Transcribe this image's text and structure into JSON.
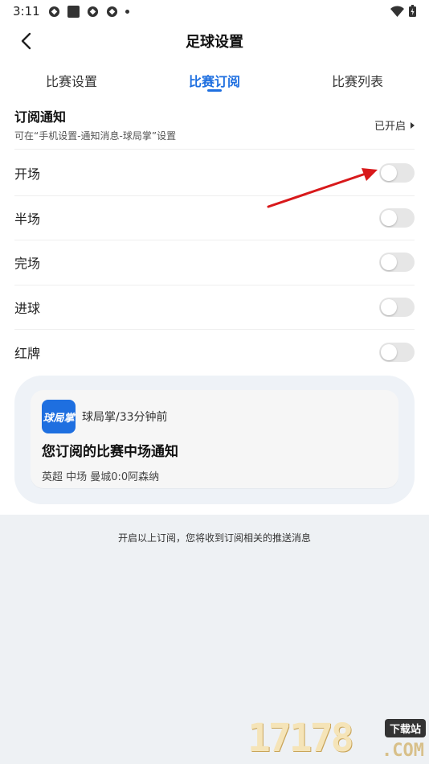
{
  "status_bar": {
    "time": "3:11"
  },
  "nav": {
    "title": "足球设置"
  },
  "tabs": [
    {
      "label": "比赛设置",
      "active": false
    },
    {
      "label": "比赛订阅",
      "active": true
    },
    {
      "label": "比赛列表",
      "active": false
    }
  ],
  "subscription": {
    "title": "订阅通知",
    "description": "可在“手机设置-通知消息-球局掌”设置",
    "status": "已开启"
  },
  "events": [
    {
      "label": "开场"
    },
    {
      "label": "半场"
    },
    {
      "label": "完场"
    },
    {
      "label": "进球"
    },
    {
      "label": "红牌"
    }
  ],
  "preview": {
    "app_icon_text": "球局掌",
    "meta": "球局掌/33分钟前",
    "title": "您订阅的比赛中场通知",
    "body": "英超 中场 曼城0:0阿森纳"
  },
  "footer": {
    "note": "开启以上订阅，您将收到订阅相关的推送消息"
  },
  "watermark": {
    "number": "17178",
    "badge": "下载站",
    "suffix": ".COM"
  },
  "colors": {
    "accent": "#1e6fe0",
    "arrow": "#d8191b",
    "toggle_off": "#e6e6e6"
  }
}
